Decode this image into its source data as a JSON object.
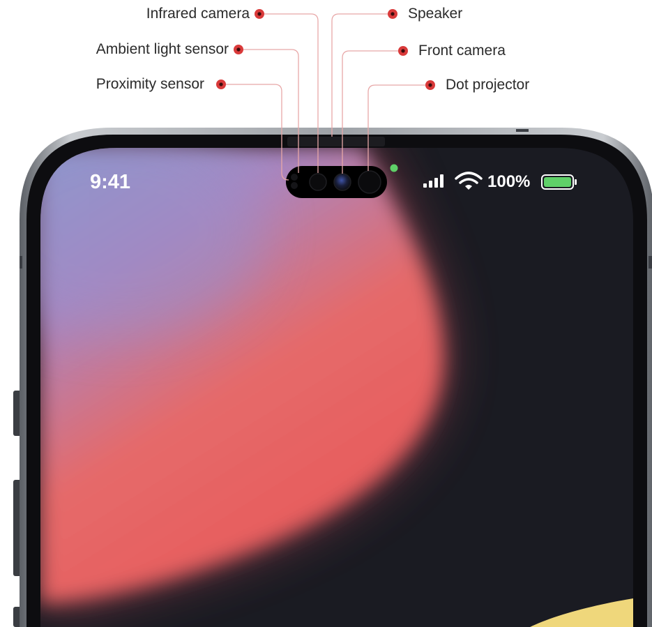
{
  "labels": {
    "infrared_camera": "Infrared camera",
    "ambient_light_sensor": "Ambient light sensor",
    "proximity_sensor": "Proximity sensor",
    "speaker": "Speaker",
    "front_camera": "Front camera",
    "dot_projector": "Dot projector"
  },
  "status_bar": {
    "time": "9:41",
    "battery_percent": "100%",
    "signal_icon": "cellular-signal-icon",
    "wifi_icon": "wifi-icon",
    "battery_icon": "battery-full-icon",
    "privacy_indicator": "camera-in-use-dot"
  },
  "colors": {
    "callout": "#d93a3a",
    "leader_line": "#e8a8a8",
    "screen": "#1a1b22",
    "wallpaper_red": "#ee5c5c",
    "wallpaper_purple": "#a886c0",
    "wallpaper_blue": "#7f9fd2",
    "wallpaper_yellow": "#efd77b",
    "battery_fill": "#5fd068",
    "privacy_dot": "#5fd068",
    "frame": "#8c9096"
  }
}
